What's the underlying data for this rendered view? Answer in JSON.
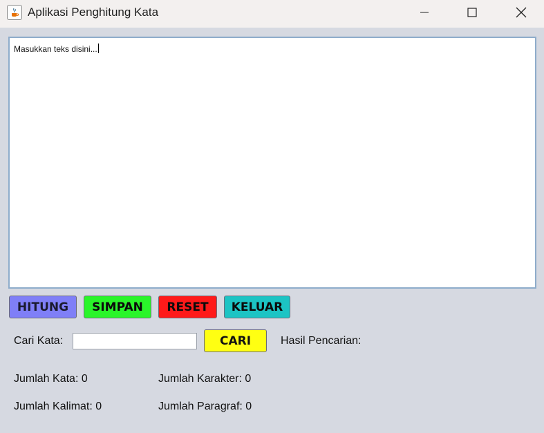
{
  "window": {
    "title": "Aplikasi Penghitung Kata",
    "icon": "java-cup-icon"
  },
  "editor": {
    "text": "Masukkan teks disini..."
  },
  "buttons": {
    "hitung": "HITUNG",
    "simpan": "SIMPAN",
    "reset": "RESET",
    "keluar": "KELUAR",
    "cari": "CARI"
  },
  "search": {
    "label": "Cari Kata:",
    "value": "",
    "result_label": "Hasil Pencarian:"
  },
  "stats": {
    "kata": "Jumlah Kata: 0",
    "karakter": "Jumlah Karakter: 0",
    "kalimat": "Jumlah Kalimat: 0",
    "paragraf": "Jumlah Paragraf: 0"
  },
  "colors": {
    "hitung": "#7f7ff7",
    "simpan": "#2af52a",
    "reset": "#ff1a1a",
    "keluar": "#1cc4c4",
    "cari": "#ffff12"
  }
}
